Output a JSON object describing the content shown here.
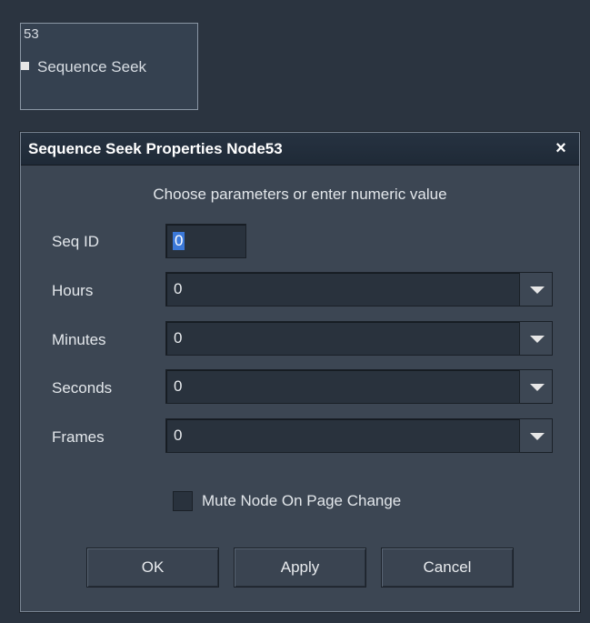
{
  "node": {
    "number": "53",
    "label": "Sequence Seek"
  },
  "dialog": {
    "title": "Sequence Seek Properties Node53",
    "close_glyph": "×",
    "instructions": "Choose parameters or enter numeric value",
    "fields": {
      "seq_id": {
        "label": "Seq ID",
        "value": "0"
      },
      "hours": {
        "label": "Hours",
        "value": "0"
      },
      "minutes": {
        "label": "Minutes",
        "value": "0"
      },
      "seconds": {
        "label": "Seconds",
        "value": "0"
      },
      "frames": {
        "label": "Frames",
        "value": "0"
      }
    },
    "mute_checkbox": {
      "label": "Mute Node On Page Change",
      "checked": false
    },
    "buttons": {
      "ok": "OK",
      "apply": "Apply",
      "cancel": "Cancel"
    }
  },
  "icons": {
    "close": "close-icon",
    "dropdown": "chevron-down-icon",
    "port": "port-icon"
  },
  "colors": {
    "background": "#2b3440",
    "dialog": "#3c4653",
    "titlebar": "#1f2a37",
    "input": "#29323d",
    "selection": "#3b78d8"
  }
}
